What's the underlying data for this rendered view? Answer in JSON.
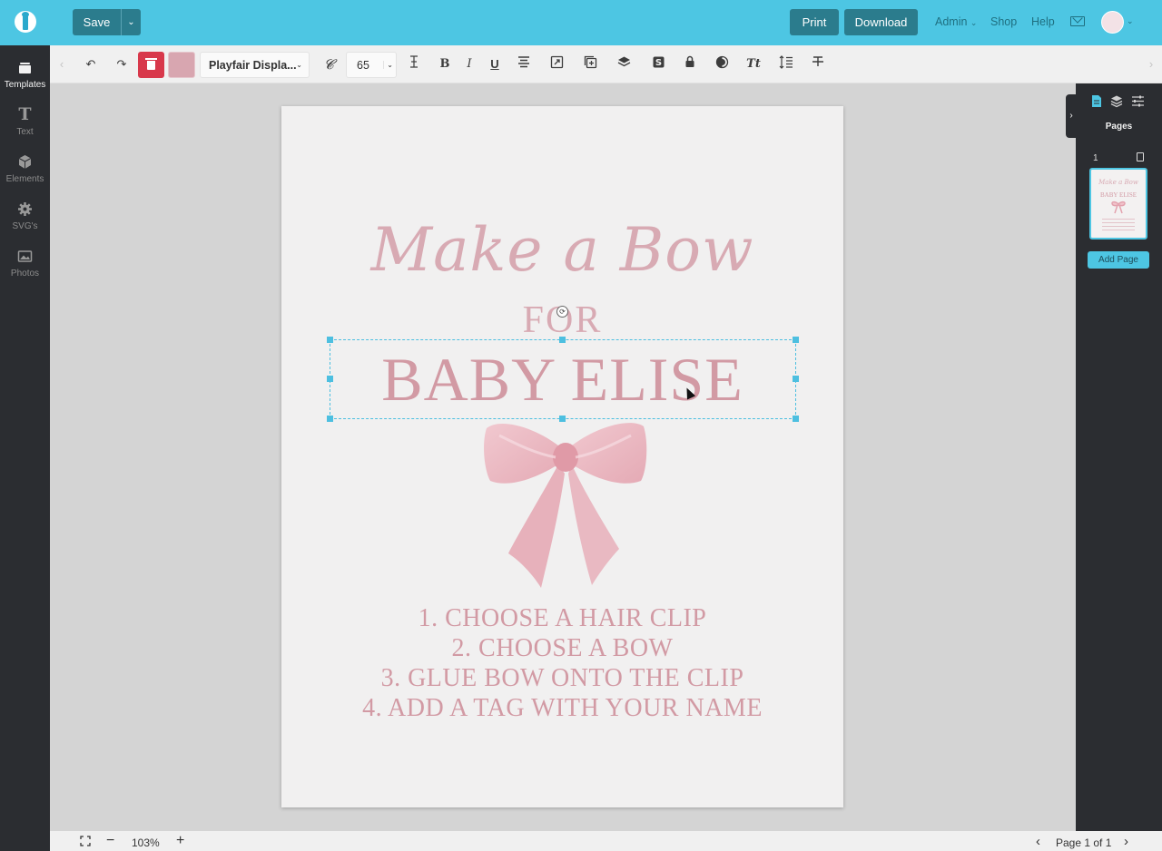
{
  "topbar": {
    "save_label": "Save",
    "save_menu_icon": "chevron-down-icon",
    "print_label": "Print",
    "download_label": "Download",
    "nav": [
      {
        "label": "Admin",
        "has_dropdown": true
      },
      {
        "label": "Shop"
      },
      {
        "label": "Help"
      }
    ],
    "mail_icon": "mail-icon",
    "avatar_text": ""
  },
  "sidebar": {
    "items": [
      {
        "label": "Templates",
        "icon": "templates-icon",
        "active": true
      },
      {
        "label": "Text",
        "icon": "text-icon",
        "active": false
      },
      {
        "label": "Elements",
        "icon": "cube-icon",
        "active": false
      },
      {
        "label": "SVG's",
        "icon": "gear-icon",
        "active": false
      },
      {
        "label": "Photos",
        "icon": "image-icon",
        "active": false
      }
    ]
  },
  "toolbar": {
    "font_family": "Playfair Displa...",
    "font_size": "65",
    "text_color": "#d8a6b0",
    "tools": [
      "undo-icon",
      "redo-icon",
      "trash-icon",
      "color-swatch",
      "font-select",
      "font-style-icon",
      "font-size",
      "line-height-icon",
      "bold-icon",
      "italic-icon",
      "underline-icon",
      "align-center-icon",
      "resize-icon",
      "duplicate-icon",
      "layers-icon",
      "dollar-icon",
      "lock-icon",
      "opacity-icon",
      "text-transform-icon",
      "spacing-icon",
      "strikethrough-icon"
    ]
  },
  "canvas": {
    "title": "Make a Bow",
    "subtitle": "FOR",
    "name": "BABY ELISE",
    "steps": [
      "1. CHOOSE A HAIR CLIP",
      "2. CHOOSE A BOW",
      "3. GLUE BOW ONTO THE CLIP",
      "4. ADD A TAG WITH YOUR NAME"
    ],
    "accent": "#d29aa4"
  },
  "right_panel": {
    "title": "Pages",
    "page_number": "1",
    "add_page_label": "Add Page",
    "thumb_title": "Make a Bow",
    "thumb_name": "BABY ELISE"
  },
  "bottombar": {
    "zoom": "103%",
    "page_indicator": "Page 1 of 1"
  }
}
